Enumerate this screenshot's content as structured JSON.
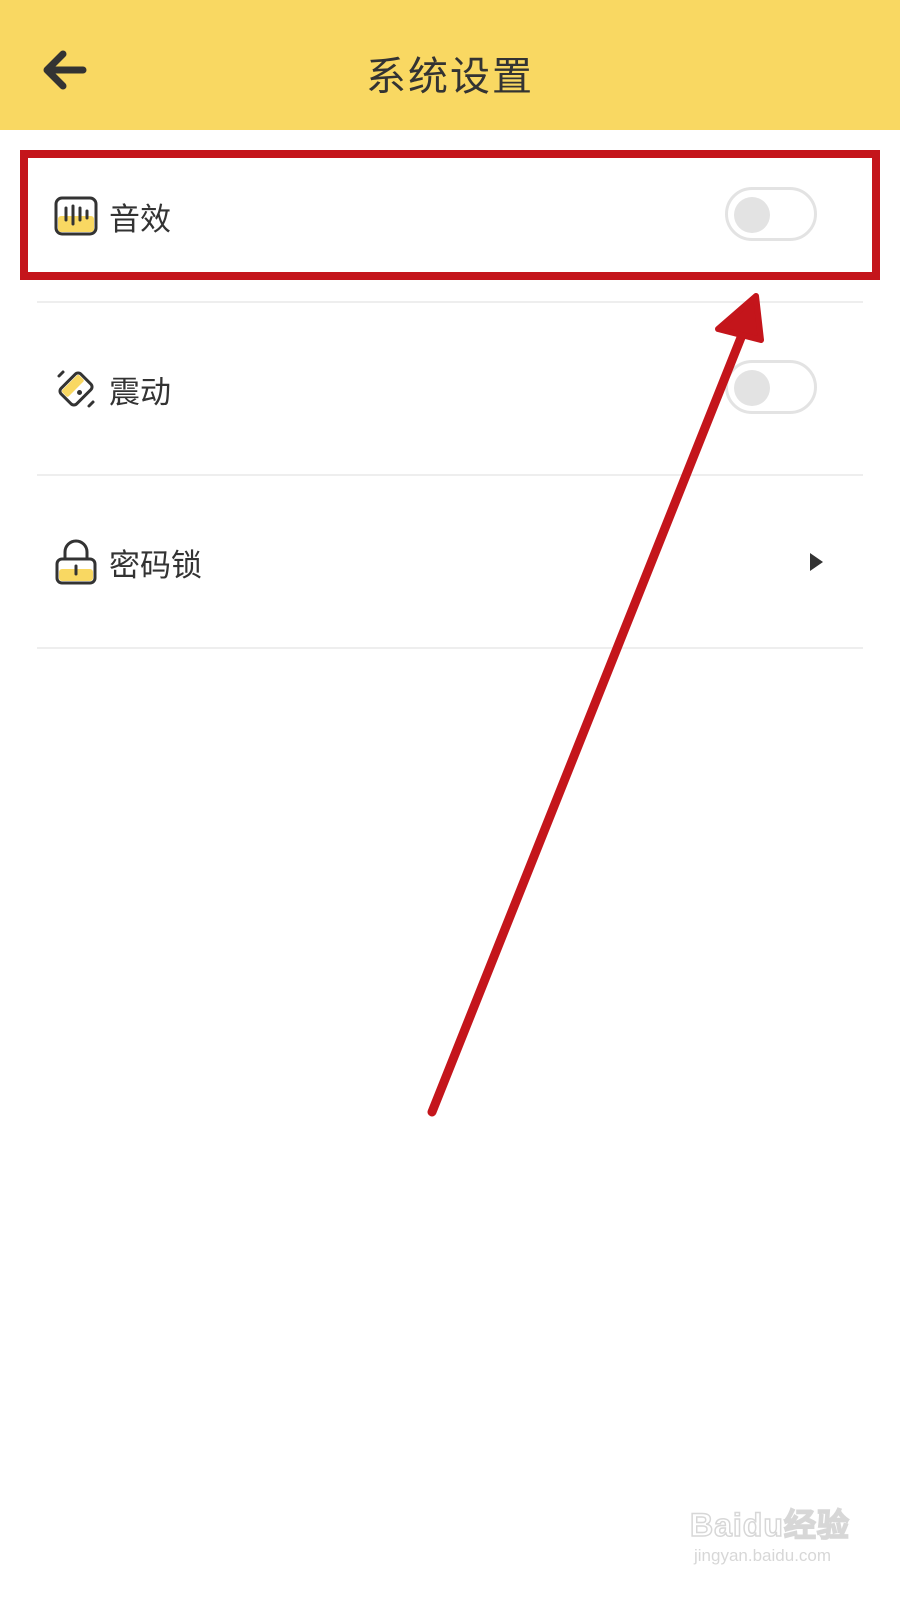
{
  "header": {
    "title": "系统设置",
    "back_icon": "arrow-left-icon",
    "background": "#f9d862"
  },
  "settings": [
    {
      "label": "音效",
      "icon": "sound-wave-icon",
      "control": "toggle",
      "on": false
    },
    {
      "label": "震动",
      "icon": "vibration-icon",
      "control": "toggle",
      "on": false
    },
    {
      "label": "密码锁",
      "icon": "padlock-icon",
      "control": "chevron"
    }
  ],
  "annotation": {
    "highlight_color": "#c4151b",
    "highlighted_item": "音效"
  },
  "watermark": {
    "main": "Baidu经验",
    "sub": "jingyan.baidu.com"
  }
}
